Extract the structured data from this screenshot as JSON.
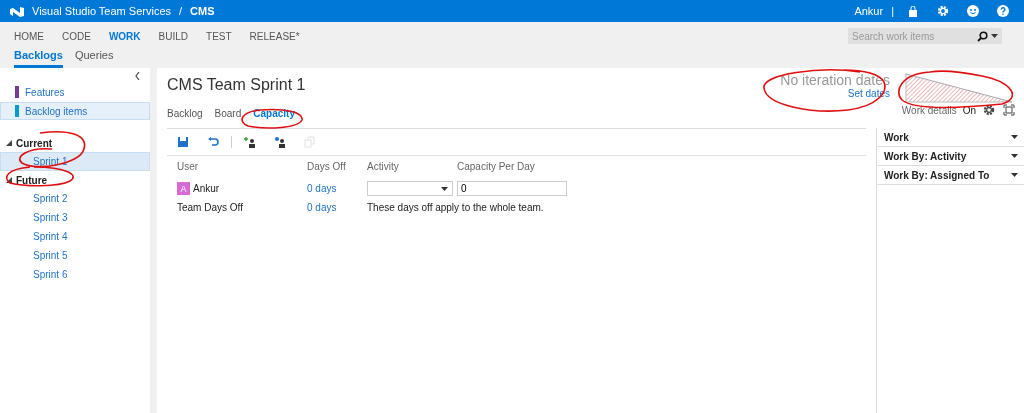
{
  "header": {
    "product": "Visual Studio Team Services",
    "separator": "/",
    "project": "CMS",
    "user": "Ankur",
    "divider": "|"
  },
  "nav": {
    "hubs": [
      {
        "label": "HOME",
        "selected": false
      },
      {
        "label": "CODE",
        "selected": false
      },
      {
        "label": "WORK",
        "selected": true
      },
      {
        "label": "BUILD",
        "selected": false
      },
      {
        "label": "TEST",
        "selected": false
      },
      {
        "label": "RELEASE*",
        "selected": false
      }
    ],
    "subhubs": [
      {
        "label": "Backlogs",
        "selected": true
      },
      {
        "label": "Queries",
        "selected": false
      }
    ],
    "search": {
      "placeholder": "Search work items"
    }
  },
  "sidebar": {
    "backlogs": [
      {
        "label": "Features",
        "color": "#773b93",
        "selected": false
      },
      {
        "label": "Backlog items",
        "color": "#009ccc",
        "selected": true
      }
    ],
    "iterations": [
      {
        "label": "Current",
        "expanded": true,
        "children": [
          {
            "label": "Sprint 1",
            "selected": true
          }
        ]
      },
      {
        "label": "Future",
        "expanded": true,
        "children": [
          {
            "label": "Sprint 2",
            "selected": false
          },
          {
            "label": "Sprint 3",
            "selected": false
          },
          {
            "label": "Sprint 4",
            "selected": false
          },
          {
            "label": "Sprint 5",
            "selected": false
          },
          {
            "label": "Sprint 6",
            "selected": false
          }
        ]
      }
    ]
  },
  "sprint": {
    "title": "CMS Team Sprint 1",
    "tabs": [
      {
        "label": "Backlog",
        "selected": false
      },
      {
        "label": "Board",
        "selected": false
      },
      {
        "label": "Capacity",
        "selected": true
      }
    ],
    "iteration_dates": {
      "message": "No iteration dates",
      "link": "Set dates"
    },
    "work_details": {
      "label": "Work details",
      "value": "On"
    }
  },
  "toolbar": [
    {
      "kind": "save",
      "disabled": false
    },
    {
      "kind": "undo",
      "disabled": false
    },
    {
      "kind": "separator"
    },
    {
      "kind": "add-user",
      "disabled": false
    },
    {
      "kind": "copy-users",
      "disabled": false
    },
    {
      "kind": "copy",
      "disabled": true
    }
  ],
  "capacity": {
    "columns": [
      "User",
      "Days Off",
      "Activity",
      "Capacity Per Day"
    ],
    "rows": [
      {
        "kind": "member",
        "user": "Ankur",
        "initial": "A",
        "days_off": "0 days",
        "capacity": "0"
      },
      {
        "kind": "team",
        "user": "Team Days Off",
        "days_off": "0 days",
        "note": "These days off apply to the whole team."
      }
    ]
  },
  "side_panel": [
    {
      "label": "Work"
    },
    {
      "label": "Work By: Activity"
    },
    {
      "label": "Work By: Assigned To"
    }
  ]
}
